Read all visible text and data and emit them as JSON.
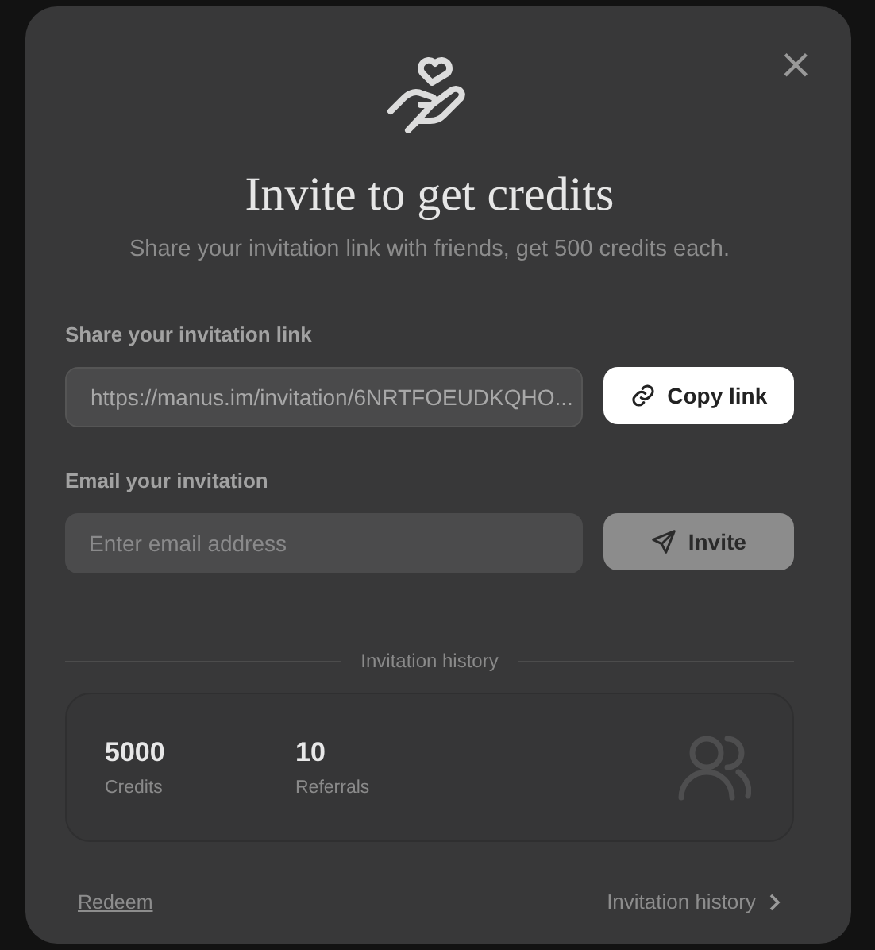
{
  "dialog": {
    "title": "Invite to get credits",
    "subtitle": "Share your invitation link with friends, get 500 credits each.",
    "close": "×"
  },
  "share": {
    "label": "Share your invitation link",
    "value": "https://manus.im/invitation/6NRTFOEUDKQHO...",
    "button": {
      "label": "Copy link",
      "disabled": false
    }
  },
  "email": {
    "label": "Email your invitation",
    "placeholder": "Enter email address",
    "button": {
      "label": "Invite",
      "disabled": true
    }
  },
  "history": {
    "heading": "Invitation history",
    "stats": [
      {
        "value": "5000",
        "label": "Credits"
      },
      {
        "value": "10",
        "label": "Referrals"
      }
    ]
  },
  "footer": {
    "redeem": "Redeem",
    "history_link": "Invitation history"
  }
}
